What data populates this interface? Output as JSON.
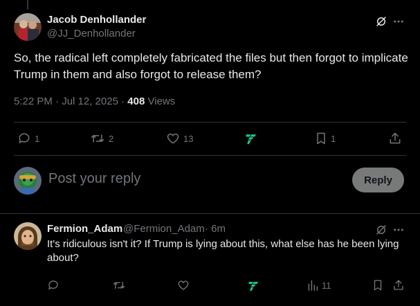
{
  "main_tweet": {
    "author_name": "Jacob Denhollander",
    "author_handle": "@JJ_Denhollander",
    "text": "So, the radical left completely fabricated the files but then forgot to implicate Trump in them and also forgot to release them?",
    "time": "5:22 PM · Jul 12, 2025 · ",
    "views_count": "408",
    "views_label": " Views",
    "actions": {
      "replies": "1",
      "reposts": "2",
      "likes": "13",
      "bookmarks": "1"
    }
  },
  "composer": {
    "placeholder": "Post your reply",
    "reply_button": "Reply"
  },
  "reply": {
    "author_name": "Fermion_Adam",
    "author_handle": "@Fermion_Adam",
    "time": "· 6m",
    "text": "It's ridiculous isn't it? If Trump is lying about this, what else has he been lying about?",
    "actions": {
      "views": "11"
    }
  },
  "colors": {
    "background": "#000000",
    "text": "#e7e9ea",
    "muted": "#71767b",
    "divider": "#2f3336",
    "grok_accent": "#1dc98b"
  }
}
